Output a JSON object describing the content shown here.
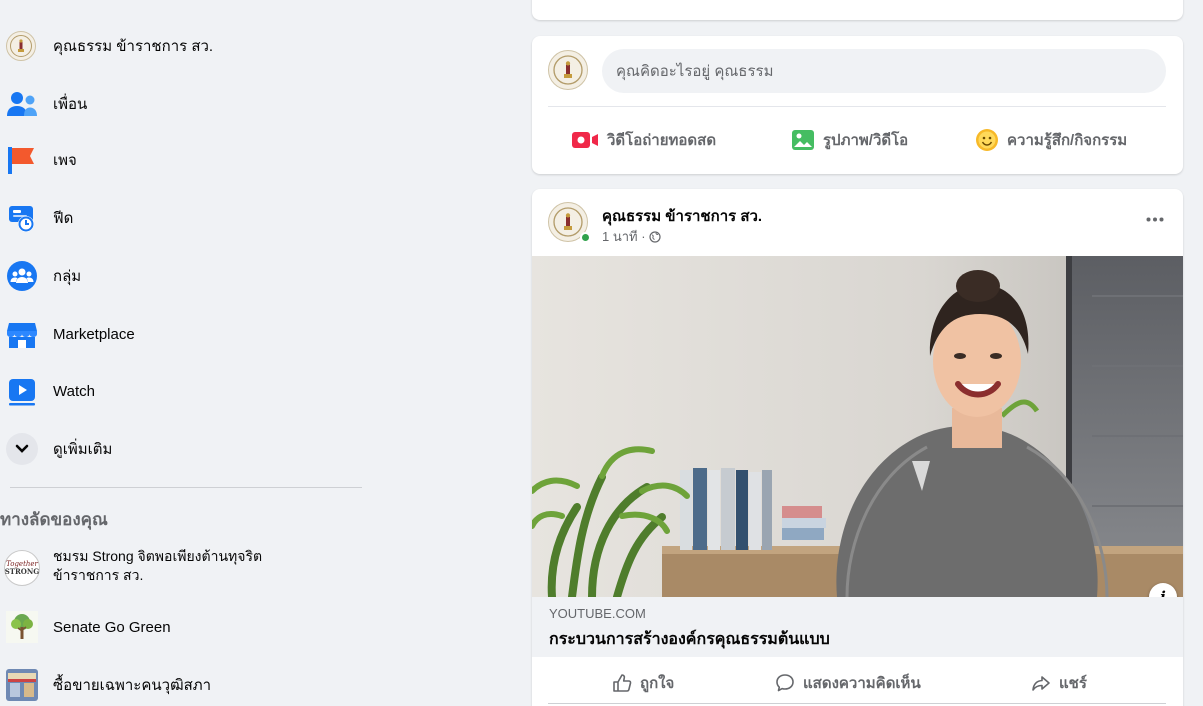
{
  "sidebar": {
    "profile_name": "คุณธรรม ข้าราชการ สว.",
    "items": [
      {
        "label": "เพื่อน",
        "icon": "friends-icon"
      },
      {
        "label": "เพจ",
        "icon": "pages-flag-icon"
      },
      {
        "label": "ฟีด",
        "icon": "feeds-clock-icon"
      },
      {
        "label": "กลุ่ม",
        "icon": "groups-icon"
      },
      {
        "label": "Marketplace",
        "icon": "marketplace-shop-icon"
      },
      {
        "label": "Watch",
        "icon": "watch-play-icon"
      },
      {
        "label": "ดูเพิ่มเติม",
        "icon": "chevron-down-icon"
      }
    ],
    "shortcuts_title": "ทางลัดของคุณ",
    "shortcuts": [
      {
        "line1": "ชมรม Strong จิตพอเพียงต้านทุจริต",
        "line2": "ข้าราชการ สว.",
        "icon": "together-strong-logo-icon",
        "logo_text_1": "Together",
        "logo_text_2": "STRONG"
      },
      {
        "label": "Senate Go Green",
        "icon": "tree-icon"
      },
      {
        "label": "ซื้อขายเฉพาะคนวุฒิสภา",
        "icon": "market-stall-icon"
      }
    ]
  },
  "composer": {
    "placeholder": "คุณคิดอะไรอยู่ คุณธรรม",
    "actions": [
      {
        "label": "วิดีโอถ่ายทอดสด",
        "icon": "live-video-icon",
        "color": "#f02849"
      },
      {
        "label": "รูปภาพ/วิดีโอ",
        "icon": "photo-icon",
        "color": "#45bd62"
      },
      {
        "label": "ความรู้สึก/กิจกรรม",
        "icon": "feeling-smiley-icon",
        "color": "#f7b928"
      }
    ]
  },
  "post": {
    "author": "คุณธรรม ข้าราชการ สว.",
    "time": "1 นาที ·",
    "privacy_icon": "globe-icon",
    "link_domain": "YOUTUBE.COM",
    "link_title": "กระบวนการสร้างองค์กรคุณธรรมต้นแบบ",
    "reactions": [
      {
        "label": "ถูกใจ",
        "icon": "like-thumb-icon"
      },
      {
        "label": "แสดงความคิดเห็น",
        "icon": "comment-icon"
      },
      {
        "label": "แชร์",
        "icon": "share-icon"
      }
    ]
  },
  "colors": {
    "background": "#f0f2f5",
    "card": "#ffffff",
    "secondary_text": "#65676b",
    "online": "#31a24c",
    "facebook_blue": "#1877f2"
  }
}
